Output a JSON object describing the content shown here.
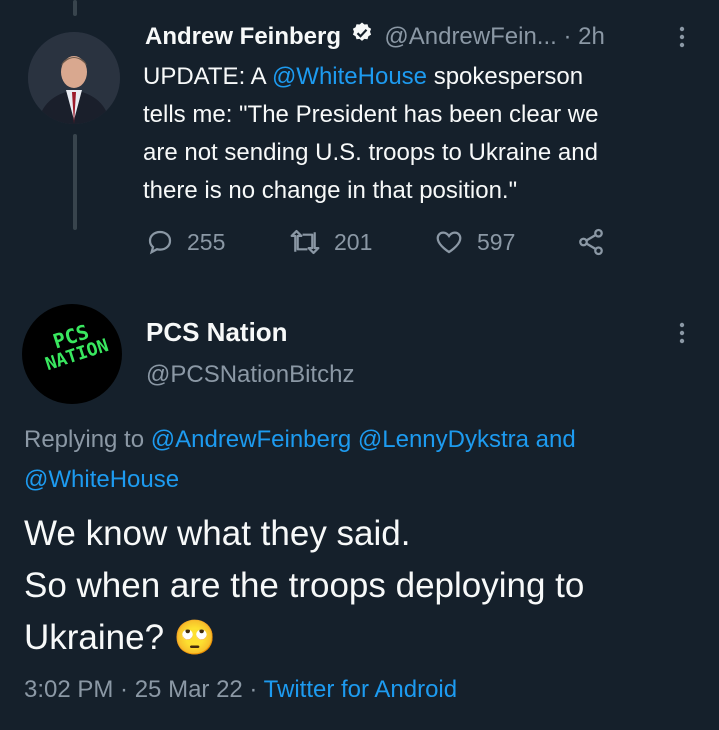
{
  "tweet1": {
    "display_name": "Andrew Feinberg",
    "handle": "@AndrewFein...",
    "time": "2h",
    "text_prefix": "UPDATE: A ",
    "mention": "@WhiteHouse",
    "text_line1_rest": " spokesperson",
    "text_line2": "tells me: \"The President has been clear we",
    "text_line3": "are not sending U.S. troops to Ukraine and",
    "text_line4": "there is no change in that position.\"",
    "replies": "255",
    "retweets": "201",
    "likes": "597"
  },
  "tweet2": {
    "display_name": "PCS Nation",
    "handle": "@PCSNationBitchz",
    "avatar_text_line1": "PCS",
    "avatar_text_line2": "NATION",
    "replying_to_label": "Replying to",
    "replying_mention1": "@AndrewFeinberg",
    "replying_mention2": "@LennyDykstra",
    "replying_and": "and",
    "replying_mention3": "@WhiteHouse",
    "text_line1": "We know what they said.",
    "text_line2": "So when are the troops deploying to",
    "text_line3": "Ukraine?",
    "emoji": "🙄",
    "timestamp": "3:02 PM · 25 Mar 22 · ",
    "source": "Twitter for Android"
  },
  "colors": {
    "background": "#15202b",
    "accent": "#1d9bf0",
    "muted": "#8b98a5",
    "text": "#f7f9f9",
    "avatar_text": "#39e75f"
  },
  "icons": [
    "verified-badge-icon",
    "more-icon",
    "reply-icon",
    "retweet-icon",
    "like-icon",
    "share-icon",
    "rolling-eyes-emoji"
  ]
}
